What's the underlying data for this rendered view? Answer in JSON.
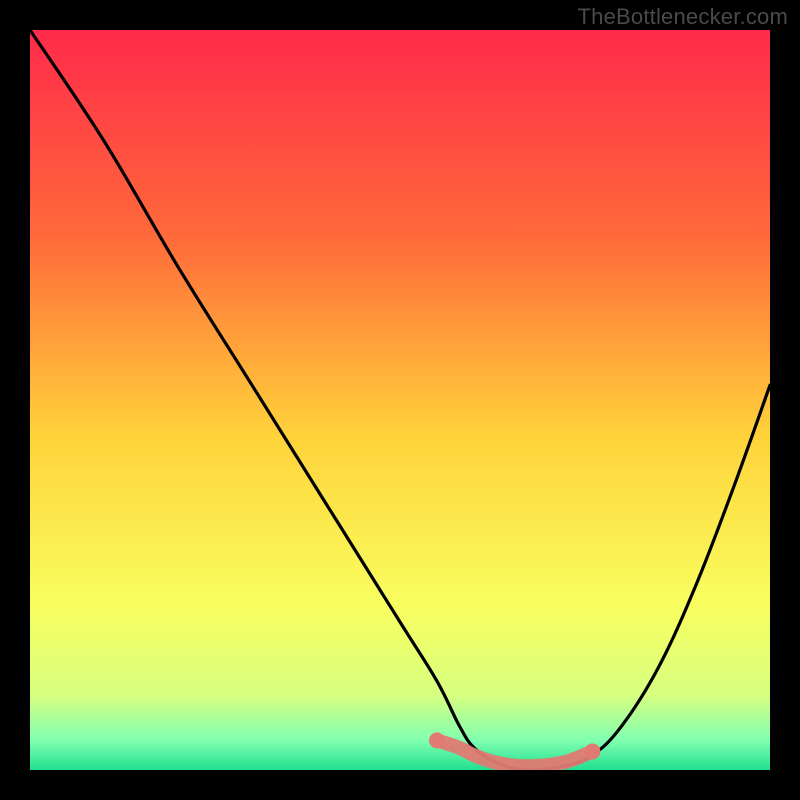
{
  "watermark": "TheBottlenecker.com",
  "colors": {
    "gradient_top": "#ff2a4a",
    "gradient_mid_upper": "#ff6a3a",
    "gradient_mid": "#ffd33a",
    "gradient_mid_lower": "#f8ff60",
    "gradient_low1": "#d6ff80",
    "gradient_low2": "#80ffb0",
    "gradient_bottom": "#20e090",
    "curve": "#000000",
    "highlight": "#e07a72"
  },
  "chart_data": {
    "type": "line",
    "title": "",
    "xlabel": "",
    "ylabel": "",
    "xlim": [
      0,
      100
    ],
    "ylim": [
      0,
      100
    ],
    "annotations": [
      "TheBottlenecker.com"
    ],
    "series": [
      {
        "name": "bottleneck-curve",
        "x": [
          0,
          10,
          20,
          30,
          40,
          50,
          55,
          58,
          60,
          63,
          67,
          72,
          76,
          80,
          85,
          90,
          95,
          100
        ],
        "y": [
          100,
          85,
          68,
          52,
          36,
          20,
          12,
          6,
          3,
          1,
          0,
          0.5,
          2,
          6,
          14,
          25,
          38,
          52
        ]
      },
      {
        "name": "optimal-band-highlight",
        "x": [
          55,
          58,
          60,
          63,
          67,
          72,
          76
        ],
        "y": [
          4,
          3,
          2,
          1,
          0.5,
          1,
          2.5
        ]
      }
    ],
    "notes": "V-shaped bottleneck curve over a vertical red→yellow→green gradient. The highlighted pink segment near the trough marks the balanced/optimal range. Axis values are normalized 0–100; no numeric tick labels are shown in the original image, so values are estimates of the depicted shape."
  }
}
